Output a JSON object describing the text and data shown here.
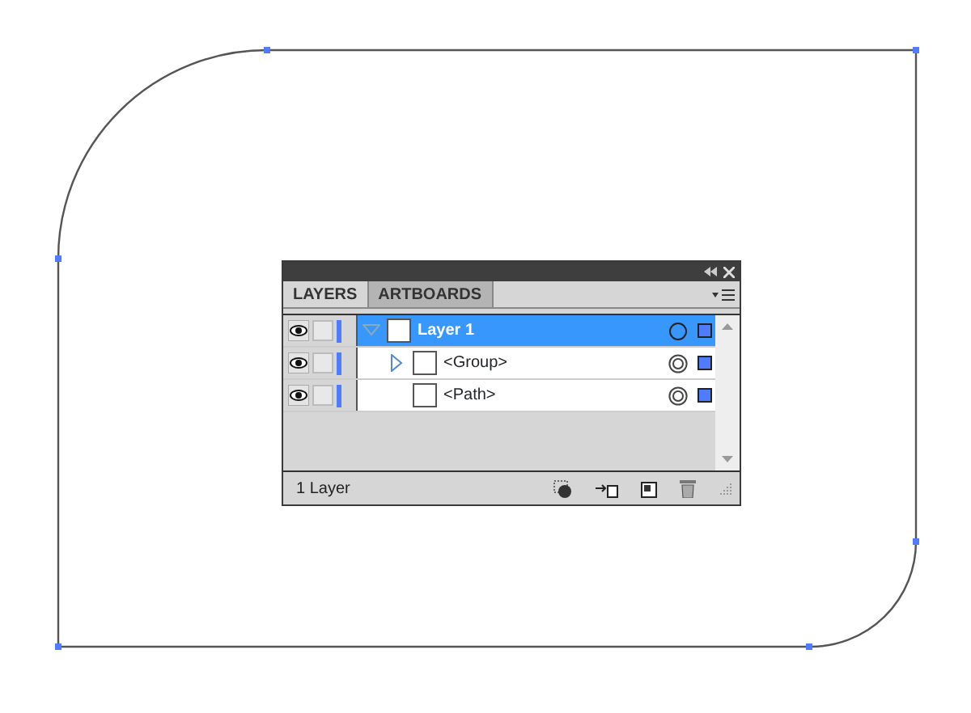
{
  "panel": {
    "tabs": [
      {
        "label": "LAYERS",
        "selected": true
      },
      {
        "label": "ARTBOARDS",
        "selected": false
      }
    ],
    "layers": [
      {
        "name": "Layer 1",
        "selected": true,
        "expandable": true,
        "expanded": true,
        "children": [
          {
            "name": "<Group>",
            "selected": false,
            "expandable": true,
            "expanded": false
          },
          {
            "name": "<Path>",
            "selected": false,
            "expandable": false
          }
        ]
      }
    ],
    "status": "1 Layer"
  }
}
